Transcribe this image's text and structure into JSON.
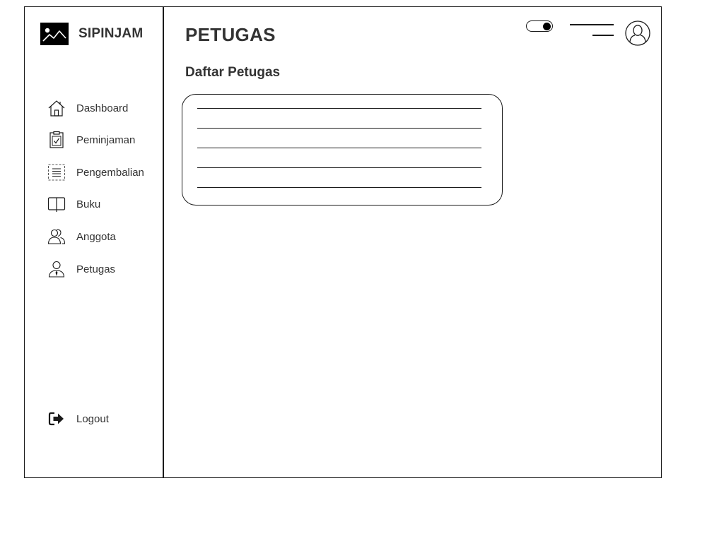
{
  "app": {
    "name": "SIPINJAM"
  },
  "sidebar": {
    "items": [
      {
        "label": "Dashboard",
        "icon": "home-icon"
      },
      {
        "label": "Peminjaman",
        "icon": "clipboard-check-icon"
      },
      {
        "label": "Pengembalian",
        "icon": "document-list-icon"
      },
      {
        "label": "Buku",
        "icon": "book-icon"
      },
      {
        "label": "Anggota",
        "icon": "users-icon"
      },
      {
        "label": "Petugas",
        "icon": "officer-icon"
      }
    ],
    "logout_label": "Logout"
  },
  "header": {
    "title": "PETUGAS",
    "toggle_state": "on"
  },
  "main": {
    "section_title": "Daftar Petugas",
    "list_rows": 5
  },
  "colors": {
    "stroke": "#1a1a1a",
    "text": "#333333",
    "background": "#ffffff"
  }
}
